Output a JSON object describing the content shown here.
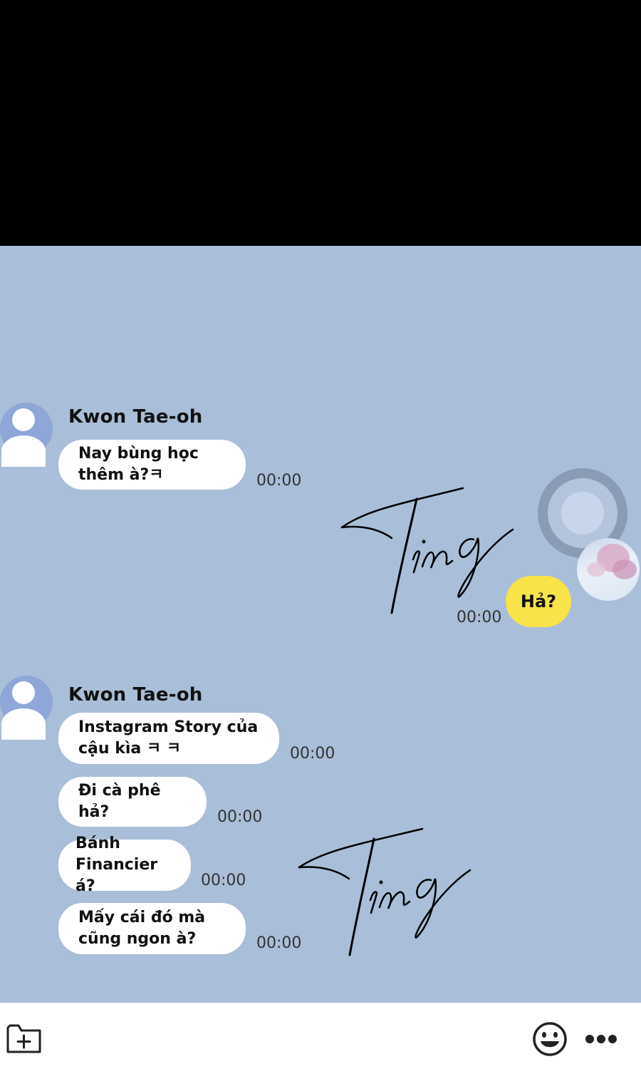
{
  "chat": {
    "group1": {
      "sender": "Kwon Tae-oh",
      "messages": [
        {
          "line1": "Nay bùng học",
          "line2": "thêm à?ㅋ",
          "time": "00:00"
        }
      ]
    },
    "my_message": {
      "text": "Hả?",
      "time": "00:00"
    },
    "group2": {
      "sender": "Kwon Tae-oh",
      "messages": [
        {
          "line1": "Instagram Story của",
          "line2": "cậu kìa ㅋ ㅋ",
          "time": "00:00"
        },
        {
          "line1": "Đi cà phê hả?",
          "time": "00:00"
        },
        {
          "line1": "Bánh",
          "line2": "Financier á?",
          "time": "00:00"
        },
        {
          "line1": "Mấy cái đó mà",
          "line2": "cũng ngon à?",
          "time": "00:00"
        }
      ]
    },
    "sfx": [
      "Ting",
      "Ting"
    ]
  },
  "toolbar": {
    "icons": [
      "add-folder-icon",
      "emoji-icon",
      "more-icon"
    ]
  },
  "colors": {
    "chat_bg": "#a9bed8",
    "my_bubble": "#f8e34a",
    "their_bubble": "#ffffff",
    "avatar": "#8ea6d8"
  }
}
